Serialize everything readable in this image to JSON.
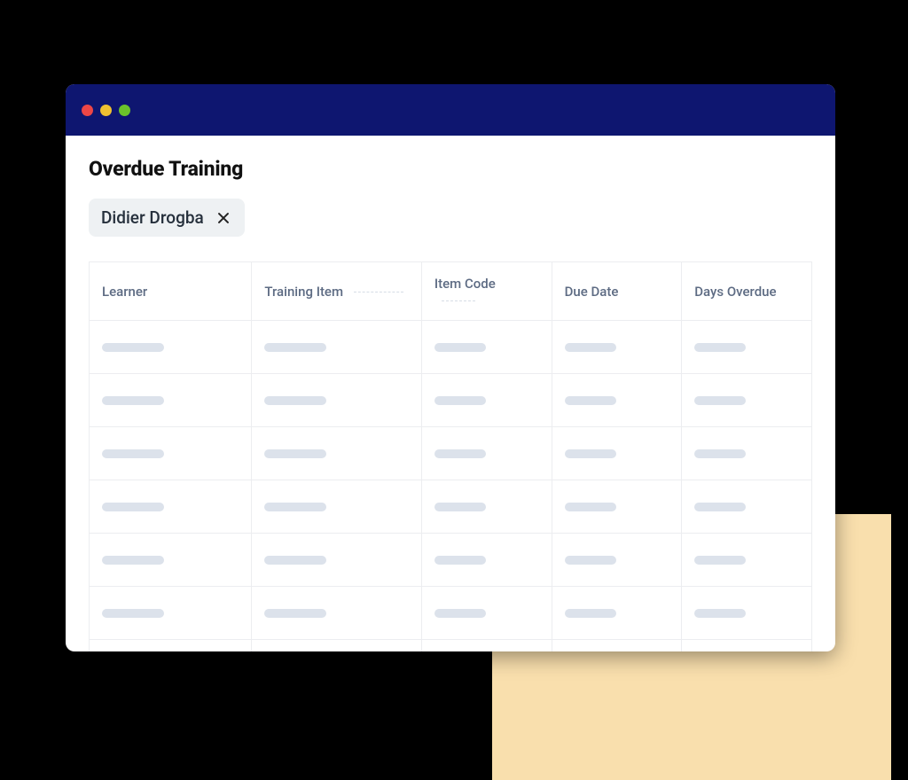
{
  "page": {
    "title": "Overdue Training"
  },
  "filter": {
    "label": "Didier Drogba"
  },
  "table": {
    "columns": [
      {
        "label": "Learner"
      },
      {
        "label": "Training Item"
      },
      {
        "label": "Item Code"
      },
      {
        "label": "Due Date"
      },
      {
        "label": "Days Overdue"
      }
    ],
    "row_count": 7
  }
}
